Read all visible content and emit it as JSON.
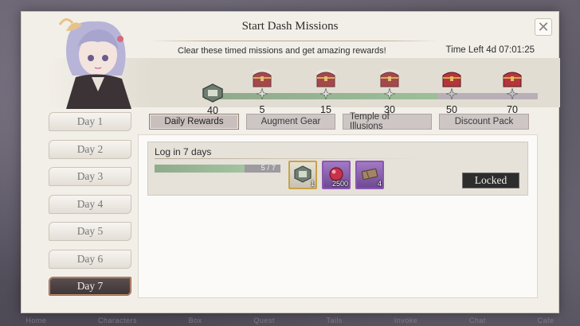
{
  "bottom_nav": [
    "Home",
    "Characters",
    "Box",
    "Quest",
    "Tails",
    "Invoke",
    "Chat",
    "Cafe"
  ],
  "panel": {
    "title": "Start Dash Missions",
    "subtitle": "Clear these timed missions and get amazing rewards!",
    "time_left": "Time Left  4d 07:01:25"
  },
  "progress": {
    "current_points": "40",
    "fill_fraction": 0.7,
    "milestones": [
      {
        "label": "5",
        "state": "claimed"
      },
      {
        "label": "15",
        "state": "claimed"
      },
      {
        "label": "30",
        "state": "claimed"
      },
      {
        "label": "50",
        "state": "locked"
      },
      {
        "label": "70",
        "state": "locked"
      }
    ]
  },
  "days": [
    "Day 1",
    "Day 2",
    "Day 3",
    "Day 4",
    "Day 5",
    "Day 6",
    "Day 7"
  ],
  "active_day": "Day 7",
  "tabs": [
    "Daily Rewards",
    "Augment Gear",
    "Temple of Illusions",
    "Discount Pack"
  ],
  "active_tab": "Daily Rewards",
  "mission": {
    "title": "Log in 7 days",
    "progress_text": "5 / 7",
    "progress_fraction": 0.714,
    "rewards": [
      {
        "icon": "gear-box-icon",
        "qty": "1",
        "rarity": "gold"
      },
      {
        "icon": "orb-currency-icon",
        "qty": "2500",
        "rarity": "purple"
      },
      {
        "icon": "ticket-icon",
        "qty": "4",
        "rarity": "purple"
      }
    ],
    "status_label": "Locked"
  },
  "colors": {
    "accent_green": "#9cbf99",
    "active_day_bg": "#3e3536",
    "reward_gold": "#c7a447",
    "reward_purple": "#8b56b3"
  }
}
